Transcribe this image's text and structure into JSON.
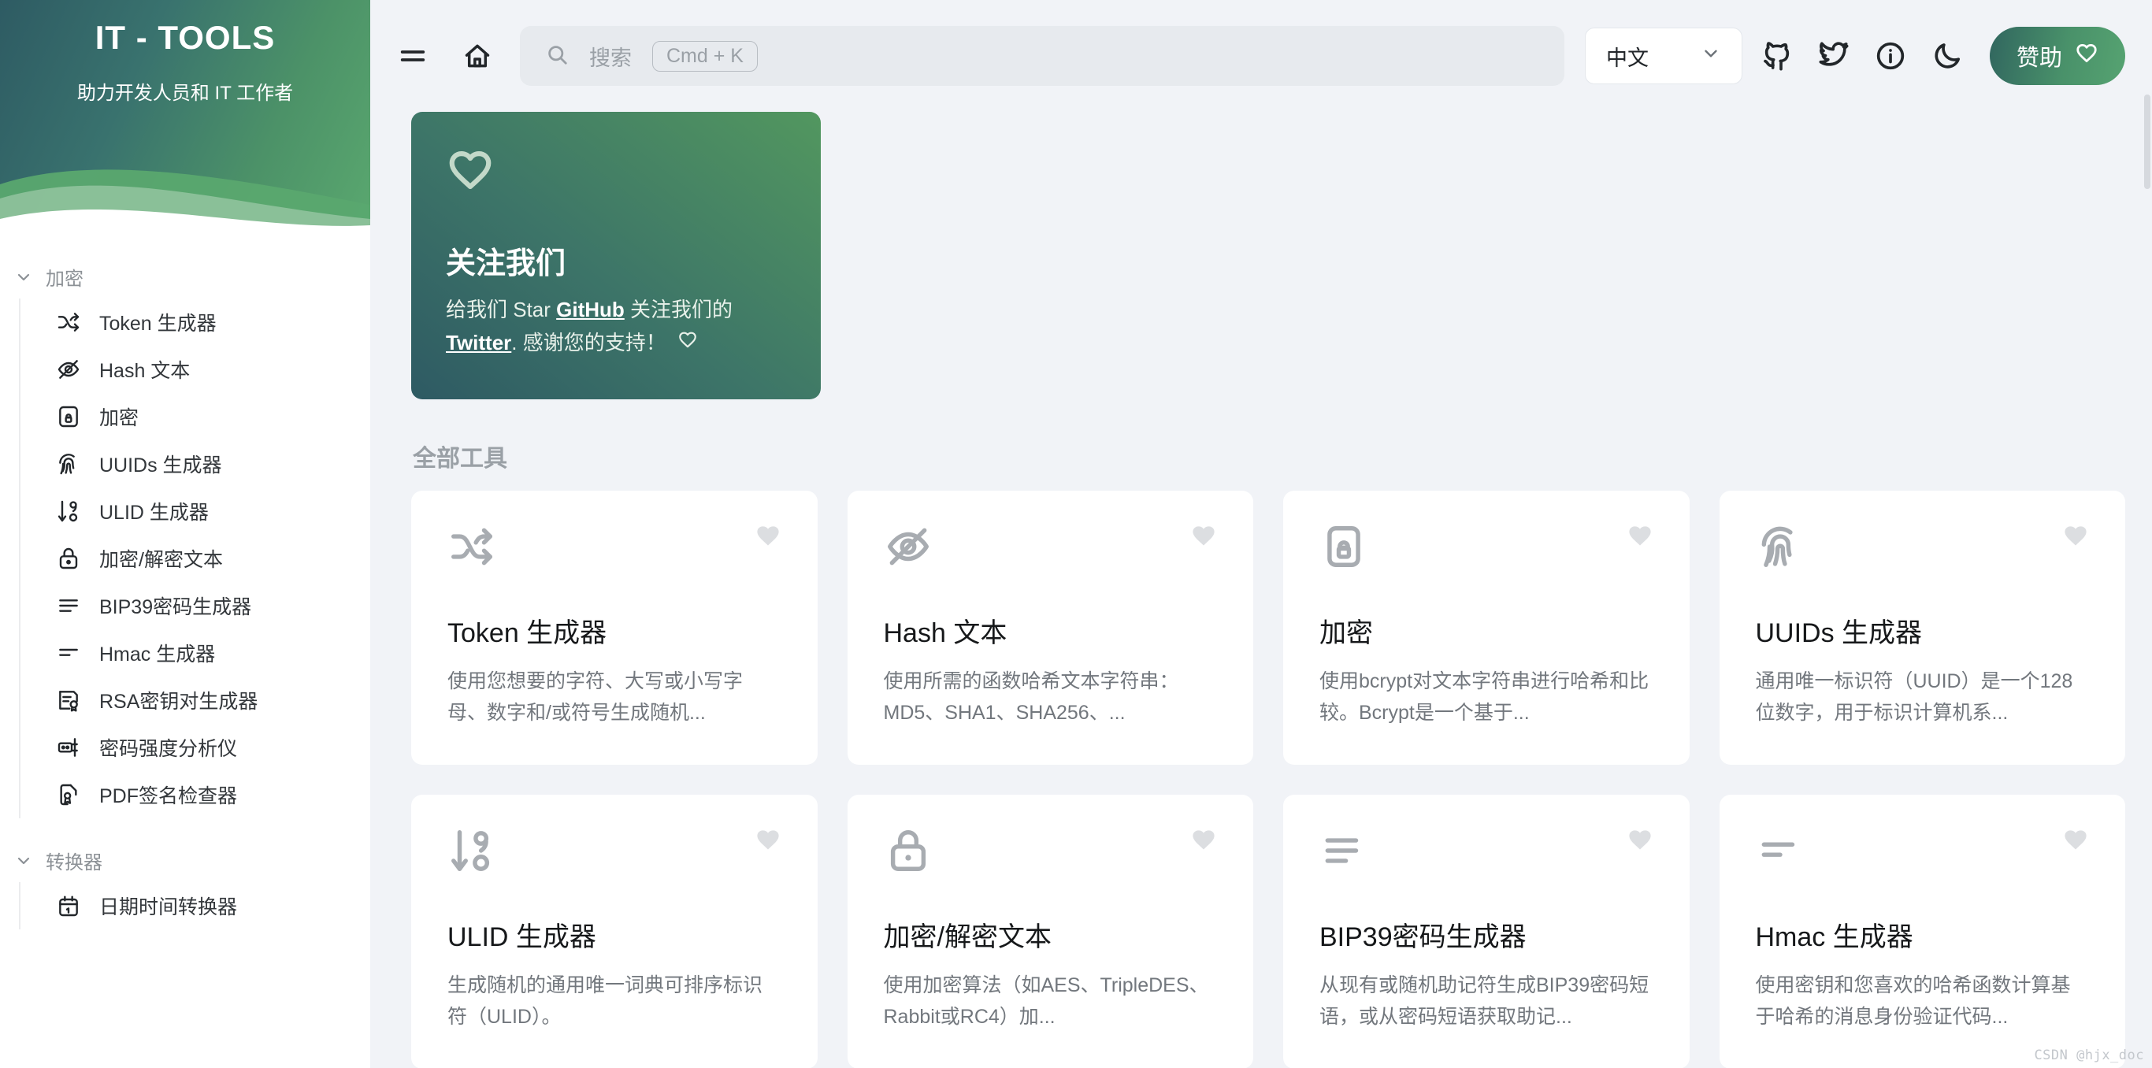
{
  "brand": {
    "title": "IT - TOOLS",
    "subtitle": "助力开发人员和 IT 工作者"
  },
  "topbar": {
    "menu_icon": "hamburger-icon",
    "home_icon": "home-icon",
    "search_placeholder": "搜索",
    "search_shortcut": "Cmd + K",
    "language": "中文",
    "github_icon": "github-icon",
    "twitter_icon": "twitter-icon",
    "info_icon": "info-icon",
    "theme_icon": "moon-icon",
    "sponsor_label": "赞助"
  },
  "hero": {
    "heart_icon": "heart-icon",
    "title": "关注我们",
    "text_before": "给我们 Star ",
    "link_github": "GitHub",
    "text_middle": " 关注我们的 ",
    "link_twitter": "Twitter",
    "text_after": ". 感谢您的支持！"
  },
  "section": {
    "all_tools": "全部工具"
  },
  "sidebar": {
    "groups": [
      {
        "label": "加密",
        "items": [
          {
            "label": "Token 生成器",
            "icon": "shuffle-icon"
          },
          {
            "label": "Hash 文本",
            "icon": "eye-off-icon"
          },
          {
            "label": "加密",
            "icon": "lock-square-icon"
          },
          {
            "label": "UUIDs 生成器",
            "icon": "fingerprint-icon"
          },
          {
            "label": "ULID 生成器",
            "icon": "sort-numeric-icon"
          },
          {
            "label": "加密/解密文本",
            "icon": "padlock-icon"
          },
          {
            "label": "BIP39密码生成器",
            "icon": "list-lines-icon"
          },
          {
            "label": "Hmac 生成器",
            "icon": "two-lines-icon"
          },
          {
            "label": "RSA密钥对生成器",
            "icon": "certificate-icon"
          },
          {
            "label": "密码强度分析仪",
            "icon": "password-meter-icon"
          },
          {
            "label": "PDF签名检查器",
            "icon": "file-certificate-icon"
          }
        ]
      },
      {
        "label": "转换器",
        "items": [
          {
            "label": "日期时间转换器",
            "icon": "calendar-icon"
          }
        ]
      }
    ]
  },
  "tools": [
    {
      "title": "Token 生成器",
      "desc": "使用您想要的字符、大写或小写字母、数字和/或符号生成随机...",
      "icon": "shuffle-icon"
    },
    {
      "title": "Hash 文本",
      "desc": "使用所需的函数哈希文本字符串：MD5、SHA1、SHA256、...",
      "icon": "eye-off-icon"
    },
    {
      "title": "加密",
      "desc": "使用bcrypt对文本字符串进行哈希和比较。Bcrypt是一个基于...",
      "icon": "lock-square-icon"
    },
    {
      "title": "UUIDs 生成器",
      "desc": "通用唯一标识符（UUID）是一个128位数字，用于标识计算机系...",
      "icon": "fingerprint-icon"
    },
    {
      "title": "ULID 生成器",
      "desc": "生成随机的通用唯一词典可排序标识符（ULID）。",
      "icon": "sort-numeric-icon"
    },
    {
      "title": "加密/解密文本",
      "desc": "使用加密算法（如AES、TripleDES、Rabbit或RC4）加...",
      "icon": "padlock-icon"
    },
    {
      "title": "BIP39密码生成器",
      "desc": "从现有或随机助记符生成BIP39密码短语，或从密码短语获取助记...",
      "icon": "list-lines-icon"
    },
    {
      "title": "Hmac 生成器",
      "desc": "使用密钥和您喜欢的哈希函数计算基于哈希的消息身份验证代码...",
      "icon": "two-lines-icon"
    }
  ],
  "watermark": "CSDN @hjx_doc",
  "colors": {
    "brand_dark": "#2e5b63",
    "brand_green": "#5aa86f",
    "page_bg": "#f1f3f7",
    "card_bg": "#ffffff",
    "muted_text": "#9aa0a6"
  }
}
